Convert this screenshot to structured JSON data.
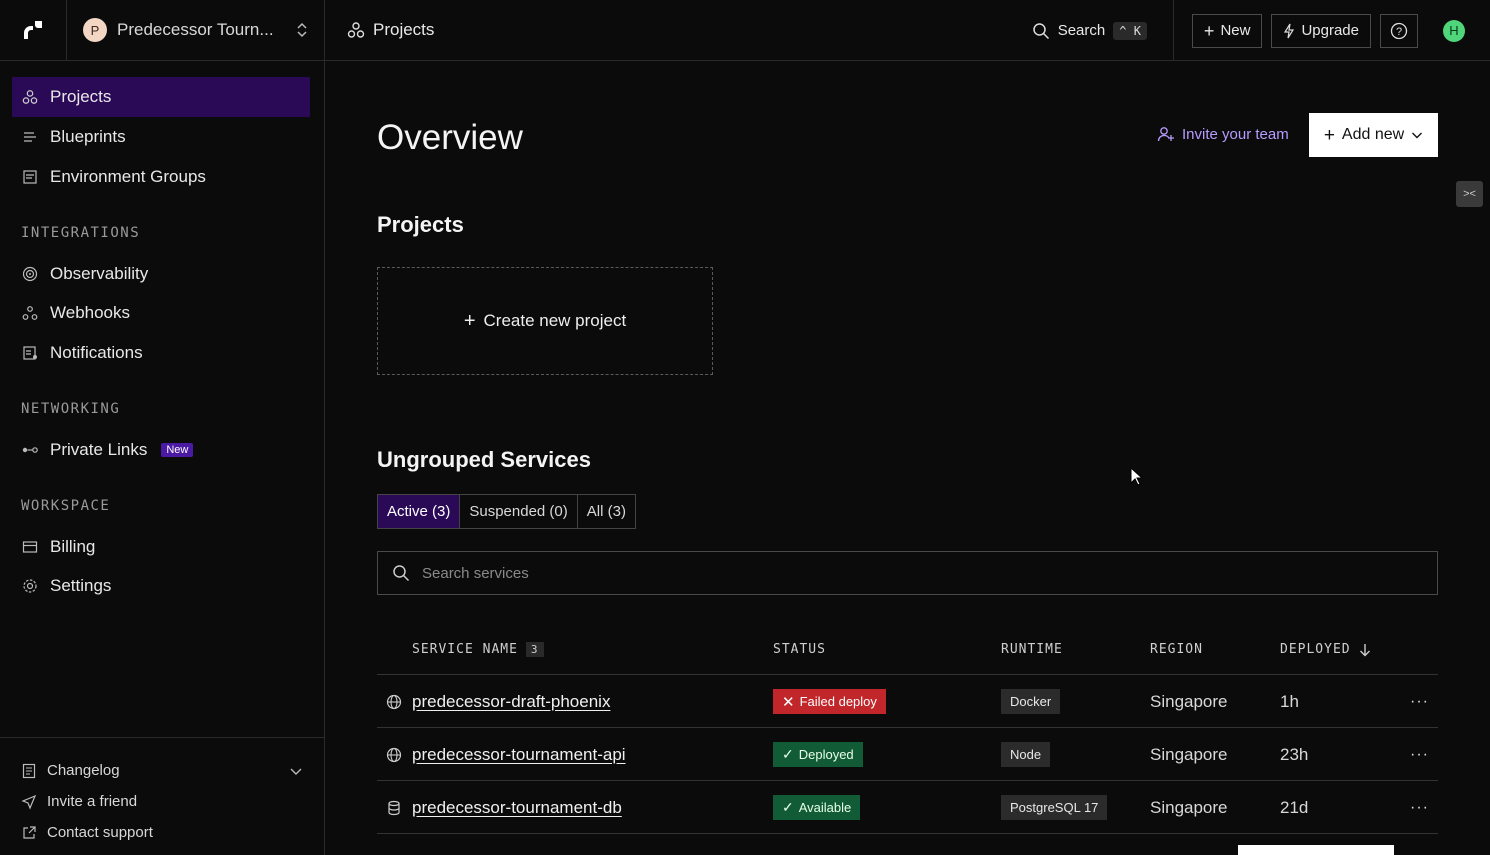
{
  "topbar": {
    "workspace_initial": "P",
    "workspace_name": "Predecessor Tourn...",
    "breadcrumb": "Projects",
    "search_label": "Search",
    "search_kbd_1": "^",
    "search_kbd_2": "K",
    "new_label": "New",
    "upgrade_label": "Upgrade",
    "user_initial": "H"
  },
  "sidebar": {
    "items": [
      {
        "label": "Projects"
      },
      {
        "label": "Blueprints"
      },
      {
        "label": "Environment Groups"
      }
    ],
    "integrations_label": "INTEGRATIONS",
    "integrations": [
      {
        "label": "Observability"
      },
      {
        "label": "Webhooks"
      },
      {
        "label": "Notifications"
      }
    ],
    "networking_label": "NETWORKING",
    "networking": [
      {
        "label": "Private Links",
        "badge": "New"
      }
    ],
    "workspace_label": "WORKSPACE",
    "workspace": [
      {
        "label": "Billing"
      },
      {
        "label": "Settings"
      }
    ],
    "footer": {
      "changelog": "Changelog",
      "invite": "Invite a friend",
      "support": "Contact support"
    }
  },
  "main": {
    "title": "Overview",
    "invite_label": "Invite your team",
    "add_new_label": "Add new",
    "projects_heading": "Projects",
    "create_project_label": "Create new project",
    "services_heading": "Ungrouped Services",
    "tabs": [
      {
        "label": "Active (3)"
      },
      {
        "label": "Suspended (0)"
      },
      {
        "label": "All (3)"
      }
    ],
    "search_placeholder": "Search services",
    "columns": {
      "service_name": "SERVICE NAME",
      "service_count": "3",
      "status": "STATUS",
      "runtime": "RUNTIME",
      "region": "REGION",
      "deployed": "DEPLOYED"
    },
    "rows": [
      {
        "name": "predecessor-draft-phoenix",
        "status": "Failed deploy",
        "runtime": "Docker",
        "region": "Singapore",
        "deployed": "1h"
      },
      {
        "name": "predecessor-tournament-api",
        "status": "Deployed",
        "runtime": "Node",
        "region": "Singapore",
        "deployed": "23h"
      },
      {
        "name": "predecessor-tournament-db",
        "status": "Available",
        "runtime": "PostgreSQL 17",
        "region": "Singapore",
        "deployed": "21d"
      }
    ],
    "more_label": "···"
  }
}
